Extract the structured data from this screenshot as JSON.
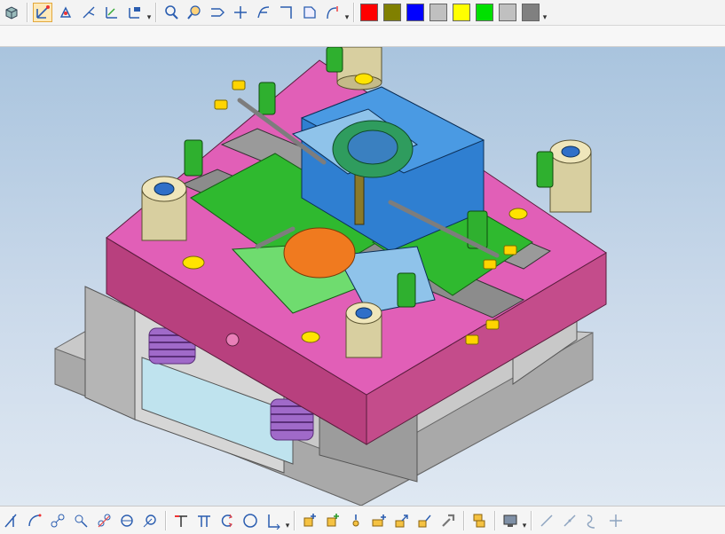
{
  "top_toolbar": {
    "groups": [
      {
        "name": "snap-tools",
        "items": [
          "view-cube-icon",
          "select-vector-icon",
          "point-snap-icon",
          "branch-snap-icon",
          "axis-snap-icon",
          "coordinate-system-icon"
        ],
        "active": "select-vector-icon"
      },
      {
        "name": "curve-tools",
        "items": [
          "zoom-search-icon",
          "pan-icon",
          "extend-curve-icon",
          "trim-curve-icon",
          "offset-curve-icon",
          "corner-icon",
          "face-icon",
          "fillet-curve-icon"
        ]
      }
    ],
    "color_swatches": [
      "#ff0000",
      "#808000",
      "#0000ff",
      "#c0c0c0",
      "#ffff00",
      "#00e000",
      "#c0c0c0",
      "#808080"
    ]
  },
  "viewport": {
    "content": "mold-assembly-3d-model",
    "colors": {
      "plate_pink": "#e15fb7",
      "plate_pink_side": "#b8407e",
      "cavity_blue": "#2f7fd1",
      "core_green": "#2fb92f",
      "rail_gray": "#8c8c8c",
      "guide_khaki": "#d8cfa0",
      "ring_green": "#2f9c5e",
      "part_orange": "#f07a1f",
      "spring_purple": "#9a5bbf",
      "bolt_yellow": "#ffe400",
      "base_gray": "#bdbdbd"
    }
  },
  "bottom_toolbar": {
    "groups": [
      {
        "name": "sketch-tools",
        "items": [
          "line-icon",
          "arc-icon",
          "spline-icon",
          "curve-point-icon",
          "link-curve-icon",
          "circle-center-icon",
          "circle-tangent-icon"
        ]
      },
      {
        "name": "dimension-tools",
        "items": [
          "perpendicular-icon",
          "parallel-icon",
          "rotate-icon",
          "circle-icon",
          "angle-corner-icon"
        ]
      },
      {
        "name": "assembly-tools",
        "items": [
          "add-component-icon",
          "add-component-alt-icon",
          "insert-point-icon",
          "add-body-icon",
          "add-arrow-icon",
          "add-link-icon",
          "tool-icon",
          "duplicate-icon",
          "display-icon"
        ]
      },
      {
        "name": "line-tools",
        "items": [
          "diagonal-line-icon",
          "diagonal-line-alt-icon",
          "wave-icon",
          "cross-icon"
        ]
      }
    ]
  }
}
